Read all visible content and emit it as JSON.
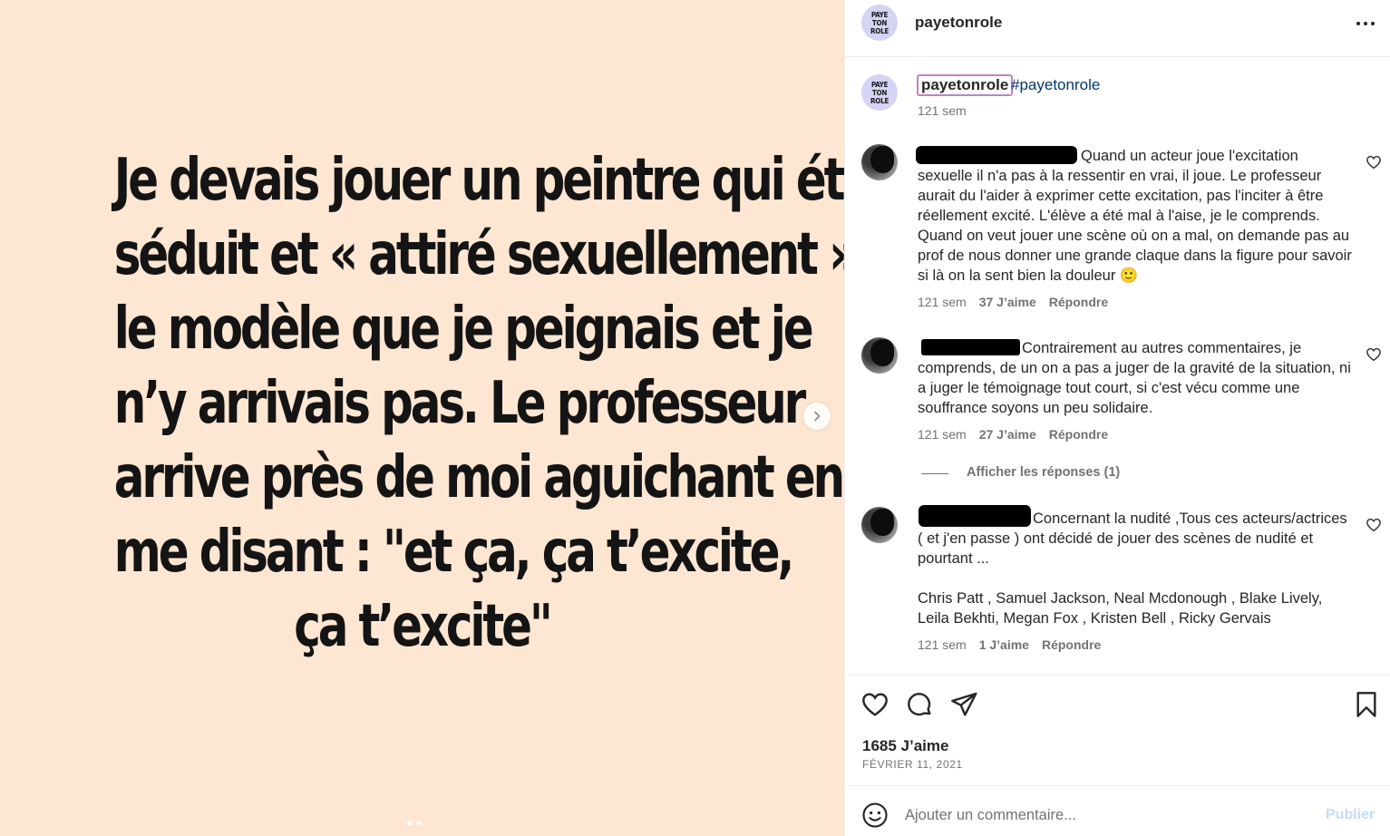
{
  "media": {
    "lines": [
      "Je devais jouer un peintre qui était",
      "séduit et « attiré sexuellement » par",
      "le modèle que je peignais et je",
      "n’y arrivais pas. Le professeur",
      "arrive près de moi aguichant en",
      "me disant : \"et ça, ça t’excite,",
      "ça t’excite\""
    ],
    "background": "#fde6d2",
    "next_icon": "chevron-right-icon",
    "slide_current": 1,
    "slide_total": 2
  },
  "header": {
    "avatar_text": [
      "PAYE",
      "TON",
      "ROLE"
    ],
    "username": "payetonrole",
    "more_icon": "ellipsis-icon"
  },
  "caption": {
    "username": "payetonrole",
    "hashtag": "#payetonrole",
    "time": "121 sem"
  },
  "comments": [
    {
      "text": "Quand un acteur joue l'excitation sexuelle il n'a pas à la ressentir en vrai, il joue. Le professeur aurait du l'aider à exprimer cette excitation, pas l'inciter à être réellement excité. L'élève a été mal à l'aise, je le comprends. Quand on veut jouer une scène où on a mal, on demande pas au prof de nous donner une grande claque dans la figure pour savoir si là on la sent bien la douleur 🙂",
      "time": "121 sem",
      "likes": "37 J’aime",
      "reply": "Répondre"
    },
    {
      "text": "Contrairement au autres commentaires, je comprends, de un on a pas a juger de la gravité de la situation, ni a juger le témoignage tout court, si c'est vécu comme une souffrance soyons un peu solidaire.",
      "time": "121 sem",
      "likes": "27 J’aime",
      "reply": "Répondre",
      "view_replies": "Afficher les réponses (1)"
    },
    {
      "text": "Concernant la nudité ,Tous ces acteurs/actrices ( et j'en passe ) ont décidé de jouer des scènes de nudité et pourtant ...",
      "text2": "Chris Patt , Samuel Jackson, Neal Mcdonough , Blake Lively, Leila Bekhti, Megan Fox , Kristen Bell , Ricky Gervais",
      "time": "121 sem",
      "likes": "1 J’aime",
      "reply": "Répondre"
    }
  ],
  "actions": {
    "like_icon": "heart-icon",
    "comment_icon": "comment-icon",
    "share_icon": "share-icon",
    "save_icon": "bookmark-icon",
    "likes": "1685 J’aime",
    "date": "FÉVRIER 11, 2021"
  },
  "add_comment": {
    "emoji_icon": "emoji-icon",
    "placeholder": "Ajouter un commentaire...",
    "publish": "Publier"
  }
}
